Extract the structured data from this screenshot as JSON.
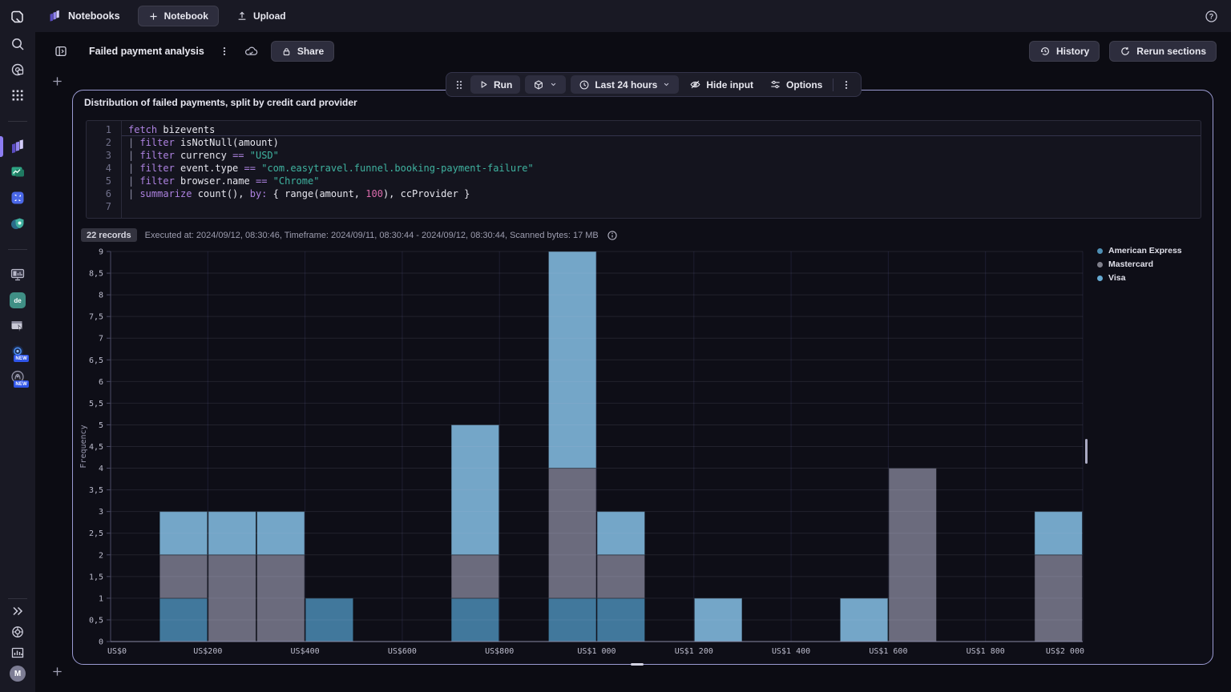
{
  "topbar": {
    "brand": "Notebooks",
    "new_notebook": "Notebook",
    "upload": "Upload"
  },
  "doc": {
    "title": "Failed payment analysis",
    "share": "Share",
    "history": "History",
    "rerun": "Rerun sections"
  },
  "toolbar": {
    "run": "Run",
    "timeframe": "Last 24 hours",
    "hide_input": "Hide input",
    "options": "Options"
  },
  "section": {
    "title": "Distribution of failed payments, split by credit card provider",
    "records_badge": "22 records",
    "exec_meta": "Executed at: 2024/09/12, 08:30:46, Timeframe: 2024/09/11, 08:30:44 - 2024/09/12, 08:30:44, Scanned bytes: 17 MB"
  },
  "code": {
    "lines": [
      [
        [
          "kw",
          "fetch"
        ],
        [
          "plain",
          " bizevents"
        ]
      ],
      [
        [
          "pipe",
          "| "
        ],
        [
          "kw",
          "filter"
        ],
        [
          "plain",
          " isNotNull(amount)"
        ]
      ],
      [
        [
          "pipe",
          "| "
        ],
        [
          "kw",
          "filter"
        ],
        [
          "plain",
          " currency "
        ],
        [
          "op",
          "=="
        ],
        [
          "plain",
          " "
        ],
        [
          "str",
          "\"USD\""
        ]
      ],
      [
        [
          "pipe",
          "| "
        ],
        [
          "kw",
          "filter"
        ],
        [
          "plain",
          " event.type "
        ],
        [
          "op",
          "=="
        ],
        [
          "plain",
          " "
        ],
        [
          "str",
          "\"com.easytravel.funnel.booking-payment-failure\""
        ]
      ],
      [
        [
          "pipe",
          "| "
        ],
        [
          "kw",
          "filter"
        ],
        [
          "plain",
          " browser.name "
        ],
        [
          "op",
          "=="
        ],
        [
          "plain",
          " "
        ],
        [
          "str",
          "\"Chrome\""
        ]
      ],
      [
        [
          "pipe",
          "| "
        ],
        [
          "kw",
          "summarize"
        ],
        [
          "plain",
          " count(), "
        ],
        [
          "kw",
          "by:"
        ],
        [
          "plain",
          " { range(amount, "
        ],
        [
          "num",
          "100"
        ],
        [
          "plain",
          "), ccProvider }"
        ]
      ],
      []
    ]
  },
  "chart_data": {
    "type": "bar",
    "subtype": "stacked-histogram",
    "title": "Distribution of failed payments, split by credit card provider",
    "xlabel": "",
    "ylabel": "Frequency",
    "x_axis": {
      "min": 0,
      "max": 2000,
      "tick_step": 200,
      "unit": "US$"
    },
    "y_axis": {
      "min": 0,
      "max": 9,
      "tick_step": 0.5,
      "decimal_separator": ","
    },
    "grid": true,
    "legend_position": "right",
    "x_ticks": [
      {
        "v": 0,
        "label": "US$0"
      },
      {
        "v": 200,
        "label": "US$200"
      },
      {
        "v": 400,
        "label": "US$400"
      },
      {
        "v": 600,
        "label": "US$600"
      },
      {
        "v": 800,
        "label": "US$800"
      },
      {
        "v": 1000,
        "label": "US$1 000"
      },
      {
        "v": 1200,
        "label": "US$1 200"
      },
      {
        "v": 1400,
        "label": "US$1 400"
      },
      {
        "v": 1600,
        "label": "US$1 600"
      },
      {
        "v": 1800,
        "label": "US$1 800"
      },
      {
        "v": 2000,
        "label": "US$2 000"
      }
    ],
    "y_ticks": [
      {
        "v": 0,
        "label": "0"
      },
      {
        "v": 0.5,
        "label": "0,5"
      },
      {
        "v": 1,
        "label": "1"
      },
      {
        "v": 1.5,
        "label": "1,5"
      },
      {
        "v": 2,
        "label": "2"
      },
      {
        "v": 2.5,
        "label": "2,5"
      },
      {
        "v": 3,
        "label": "3"
      },
      {
        "v": 3.5,
        "label": "3,5"
      },
      {
        "v": 4,
        "label": "4"
      },
      {
        "v": 4.5,
        "label": "4,5"
      },
      {
        "v": 5,
        "label": "5"
      },
      {
        "v": 5.5,
        "label": "5,5"
      },
      {
        "v": 6,
        "label": "6"
      },
      {
        "v": 6.5,
        "label": "6,5"
      },
      {
        "v": 7,
        "label": "7"
      },
      {
        "v": 7.5,
        "label": "7,5"
      },
      {
        "v": 8,
        "label": "8"
      },
      {
        "v": 8.5,
        "label": "8,5"
      },
      {
        "v": 9,
        "label": "9"
      }
    ],
    "series": [
      {
        "name": "American Express",
        "color": "#41789c",
        "dot": "#4e8fb4"
      },
      {
        "name": "Mastercard",
        "color": "#6b6b7d",
        "dot": "#7f7f8b"
      },
      {
        "name": "Visa",
        "color": "#74a6c8",
        "dot": "#66aad2"
      }
    ],
    "bins": [
      {
        "range": [
          100,
          200
        ],
        "values": {
          "American Express": 1,
          "Mastercard": 1,
          "Visa": 1
        }
      },
      {
        "range": [
          200,
          300
        ],
        "values": {
          "Mastercard": 2,
          "Visa": 1
        }
      },
      {
        "range": [
          300,
          400
        ],
        "values": {
          "Mastercard": 2,
          "Visa": 1
        }
      },
      {
        "range": [
          400,
          500
        ],
        "values": {
          "American Express": 1
        }
      },
      {
        "range": [
          700,
          800
        ],
        "values": {
          "American Express": 1,
          "Mastercard": 1,
          "Visa": 3
        }
      },
      {
        "range": [
          900,
          1000
        ],
        "values": {
          "American Express": 1,
          "Mastercard": 3,
          "Visa": 5
        }
      },
      {
        "range": [
          1000,
          1100
        ],
        "values": {
          "American Express": 1,
          "Mastercard": 1,
          "Visa": 1
        }
      },
      {
        "range": [
          1200,
          1300
        ],
        "values": {
          "Visa": 1
        }
      },
      {
        "range": [
          1500,
          1600
        ],
        "values": {
          "Visa": 1
        }
      },
      {
        "range": [
          1600,
          1700
        ],
        "values": {
          "Mastercard": 4
        }
      },
      {
        "range": [
          1900,
          2000
        ],
        "values": {
          "Mastercard": 2,
          "Visa": 1
        }
      }
    ]
  },
  "rail": {
    "avatar_letter": "M",
    "de_label": "de",
    "new_badge": "NEW",
    "icons": [
      "dynatrace-logo",
      "search",
      "discover",
      "app-grid",
      "notebooks",
      "dashboards-app",
      "kubernetes-app",
      "security-app",
      "hosts-classic-app",
      "deployments-app",
      "session-replay-app",
      "davis-app",
      "grail-app",
      "collapse-rail",
      "support",
      "usage-chart",
      "user-avatar"
    ]
  },
  "colors": {
    "accent_purple": "#8d7df2",
    "section_border": "#9b9bd2",
    "topbar_bg": "#191924",
    "canvas_bg": "#0c0c13",
    "section_bg": "#0e0e17"
  }
}
